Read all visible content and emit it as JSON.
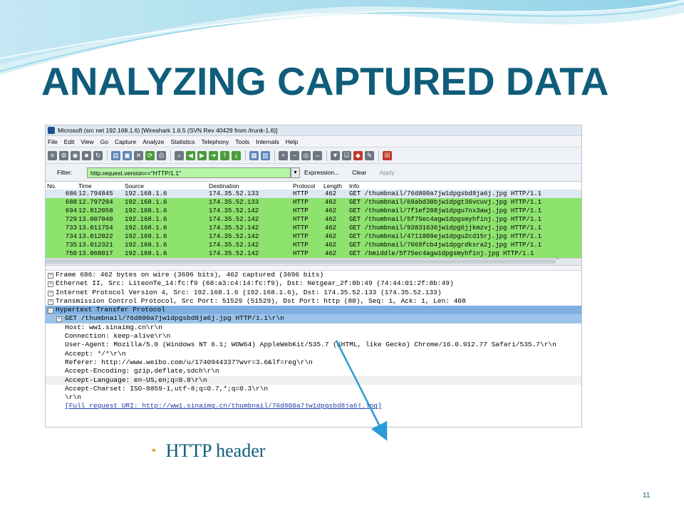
{
  "slide": {
    "title": "ANALYZING CAPTURED DATA",
    "bullet": "HTTP header",
    "page_number": "11",
    "colors": {
      "title": "#0f5d7b",
      "bullet_dot": "#e0a12c",
      "arrow": "#2a9ad8"
    }
  },
  "window": {
    "title": "Microsoft (src net 192.168.1.6)  [Wireshark 1.6.5  (SVN Rev 40429 from /trunk-1.6)]",
    "menu": [
      "File",
      "Edit",
      "View",
      "Go",
      "Capture",
      "Analyze",
      "Statistics",
      "Telephony",
      "Tools",
      "Internals",
      "Help"
    ]
  },
  "filter": {
    "label": "Filter:",
    "value": "http.request.version==\"HTTP/1.1\"",
    "expression": "Expression...",
    "clear": "Clear",
    "apply": "Apply"
  },
  "packet_list": {
    "columns": [
      "No.",
      "Time",
      "Source",
      "Destination",
      "Protocol",
      "Length",
      "Info"
    ],
    "rows": [
      {
        "no": "686",
        "time": "12.794845",
        "src": "192.168.1.6",
        "dst": "174.35.52.133",
        "proto": "HTTP",
        "len": "462",
        "info": "GET /thumbnail/76d800a7jw1dpgsbd8ja6j.jpg HTTP/1.1",
        "style": "sel"
      },
      {
        "no": "688",
        "time": "12.797284",
        "src": "192.168.1.6",
        "dst": "174.35.52.133",
        "proto": "HTTP",
        "len": "462",
        "info": "GET /thumbnail/69abd30bjw1dpgt36vcuvj.jpg HTTP/1.1",
        "style": "green"
      },
      {
        "no": "694",
        "time": "12.812058",
        "src": "192.168.1.6",
        "dst": "174.35.52.142",
        "proto": "HTTP",
        "len": "462",
        "info": "GET /thumbnail/7f1ef208jw1dpgu7nx3awj.jpg HTTP/1.1",
        "style": "green"
      },
      {
        "no": "729",
        "time": "13.007040",
        "src": "192.168.1.6",
        "dst": "174.35.52.142",
        "proto": "HTTP",
        "len": "462",
        "info": "GET /thumbnail/5f75ec4agw1dpgsmyhfinj.jpg HTTP/1.1",
        "style": "green"
      },
      {
        "no": "733",
        "time": "13.011754",
        "src": "192.168.1.6",
        "dst": "174.35.52.142",
        "proto": "HTTP",
        "len": "462",
        "info": "GET /thumbnail/93831636jw1dpg6jjkmzvj.jpg HTTP/1.1",
        "style": "green"
      },
      {
        "no": "734",
        "time": "13.012022",
        "src": "192.168.1.6",
        "dst": "174.35.52.142",
        "proto": "HTTP",
        "len": "462",
        "info": "GET /thumbnail/4711809ejw1dpgu2cd15rj.jpg HTTP/1.1",
        "style": "green"
      },
      {
        "no": "735",
        "time": "13.012321",
        "src": "192.168.1.6",
        "dst": "174.35.52.142",
        "proto": "HTTP",
        "len": "462",
        "info": "GET /thumbnail/7069fcb4jw1dpgrdksra2j.jpg HTTP/1.1",
        "style": "green"
      },
      {
        "no": "750",
        "time": "13.068017",
        "src": "192.168.1.6",
        "dst": "174.35.52.142",
        "proto": "HTTP",
        "len": "462",
        "info": "GET /bmiddle/5f75ec4agw1dpgsmyhfinj.jpg HTTP/1.1",
        "style": "green"
      }
    ]
  },
  "details": [
    {
      "text": "Frame 686: 462 bytes on wire (3696 bits), 462 captured (3696 bits)",
      "level": 0,
      "expander": "+",
      "style": ""
    },
    {
      "text": "Ethernet II, Src: LiteonTe_14:fc:f9 (68:a3:c4:14:fc:f9), Dst: Netgear_2f:8b:49 (74:44:01:2f:8b:49)",
      "level": 0,
      "expander": "+",
      "style": ""
    },
    {
      "text": "Internet Protocol Version 4, Src: 192.168.1.6 (192.168.1.6), Dst: 174.35.52.133 (174.35.52.133)",
      "level": 0,
      "expander": "+",
      "style": ""
    },
    {
      "text": "Transmission Control Protocol, Src Port: 51529 (51529), Dst Port: http (80), Seq: 1, Ack: 1, Len: 408",
      "level": 0,
      "expander": "+",
      "style": ""
    },
    {
      "text": "Hypertext Transfer Protocol",
      "level": 0,
      "expander": "-",
      "style": "hl"
    },
    {
      "text": "GET /thumbnail/76d800a7jw1dpgsbd8ja6j.jpg HTTP/1.1\\r\\n",
      "level": 1,
      "expander": "+",
      "style": "hl2"
    },
    {
      "text": "Host: ww1.sinaimg.cn\\r\\n",
      "level": 1,
      "expander": "",
      "style": ""
    },
    {
      "text": "Connection: keep-alive\\r\\n",
      "level": 1,
      "expander": "",
      "style": ""
    },
    {
      "text": "User-Agent: Mozilla/5.0 (Windows NT 6.1; WOW64) AppleWebKit/535.7 (KHTML, like Gecko) Chrome/16.0.912.77 Safari/535.7\\r\\n",
      "level": 1,
      "expander": "",
      "style": ""
    },
    {
      "text": "Accept: */*\\r\\n",
      "level": 1,
      "expander": "",
      "style": ""
    },
    {
      "text": "Referer: http://www.weibo.com/u/1740944337?wvr=3.6&lf=reg\\r\\n",
      "level": 1,
      "expander": "",
      "style": ""
    },
    {
      "text": "Accept-Encoding: gzip,deflate,sdch\\r\\n",
      "level": 1,
      "expander": "",
      "style": ""
    },
    {
      "text": "Accept-Language: en-US,en;q=0.8\\r\\n",
      "level": 1,
      "expander": "",
      "style": "alt"
    },
    {
      "text": "Accept-Charset: ISO-8859-1,utf-8;q=0.7,*;q=0.3\\r\\n",
      "level": 1,
      "expander": "",
      "style": ""
    },
    {
      "text": "\\r\\n",
      "level": 1,
      "expander": "",
      "style": ""
    },
    {
      "text": "[Full request URI: http://ww1.sinaimg.cn/thumbnail/76d800a7jw1dpgsbd8ja6j.jpg]",
      "level": 1,
      "expander": "",
      "style": "link"
    }
  ]
}
